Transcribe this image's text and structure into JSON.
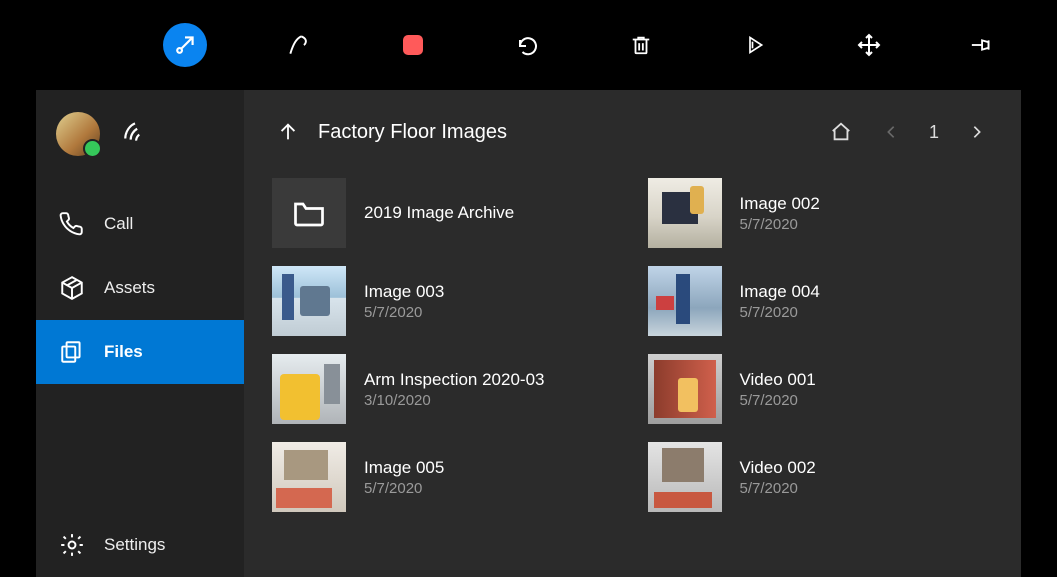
{
  "sidebar": {
    "nav": [
      {
        "icon": "phone",
        "label": "Call"
      },
      {
        "icon": "assets",
        "label": "Assets"
      },
      {
        "icon": "files",
        "label": "Files",
        "active": true
      },
      {
        "icon": "gear",
        "label": "Settings"
      }
    ]
  },
  "header": {
    "title": "Factory Floor Images",
    "page_number": "1"
  },
  "files": [
    {
      "kind": "folder",
      "name": "2019 Image Archive",
      "date": ""
    },
    {
      "kind": "image",
      "name": "Image 002",
      "date": "5/7/2020",
      "thumb": "photo-b"
    },
    {
      "kind": "image",
      "name": "Image 003",
      "date": "5/7/2020",
      "thumb": "photo-a"
    },
    {
      "kind": "image",
      "name": "Image 004",
      "date": "5/7/2020",
      "thumb": "photo-f"
    },
    {
      "kind": "image",
      "name": "Arm Inspection 2020-03",
      "date": "3/10/2020",
      "thumb": "photo-c"
    },
    {
      "kind": "video",
      "name": "Video 001",
      "date": "5/7/2020",
      "thumb": "photo-d"
    },
    {
      "kind": "image",
      "name": "Image 005",
      "date": "5/7/2020",
      "thumb": "photo-e"
    },
    {
      "kind": "video",
      "name": "Video 002",
      "date": "5/7/2020",
      "thumb": "photo-g"
    }
  ]
}
